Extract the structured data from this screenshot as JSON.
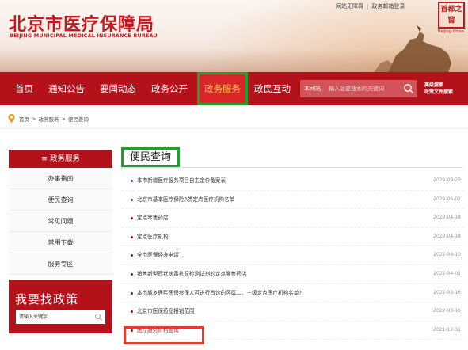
{
  "header": {
    "logo_title": "北京市医疗保障局",
    "logo_subtitle": "BEIJING MUNICIPAL MEDICAL INSURANCE BUREAU",
    "top_links": [
      "网站无障碍",
      "政务邮箱登录"
    ],
    "seal_text": "首都之窗",
    "seal_subtext": "Beijing-China"
  },
  "nav": {
    "items": [
      {
        "label": "首页"
      },
      {
        "label": "通知公告"
      },
      {
        "label": "要闻动态"
      },
      {
        "label": "政务公开"
      },
      {
        "label": "政务服务"
      },
      {
        "label": "政民互动"
      }
    ],
    "active": "政务服务",
    "search": {
      "scope_label": "本网站",
      "placeholder": "输入您要搜索的关键词"
    },
    "side_links": [
      "高级搜索",
      "政策文件搜索"
    ]
  },
  "breadcrumb": {
    "items": [
      "首页",
      "政务服务",
      "便民查询"
    ],
    "separator": ">"
  },
  "sidebar": {
    "heading": "≡ 政务服务",
    "items": [
      {
        "label": "办事指南"
      },
      {
        "label": "便民查询"
      },
      {
        "label": "常见问题"
      },
      {
        "label": "常用下载"
      },
      {
        "label": "服务专区"
      }
    ],
    "policy_title": "我要找政策",
    "policy_placeholder": "请输入关键字"
  },
  "main": {
    "title": "便民查询",
    "news": [
      {
        "title": "本市新增医疗服务项目自主定价备案表",
        "date": "2022-09-23"
      },
      {
        "title": "北京市基本医疗保险A类定点医疗机构名单",
        "date": "2022-06-02"
      },
      {
        "title": "定点零售药店",
        "date": "2022-04-18"
      },
      {
        "title": "定点医疗机构",
        "date": "2022-04-18"
      },
      {
        "title": "全市医保经办电话",
        "date": "2022-04-10"
      },
      {
        "title": "销售新型冠状病毒抗原检测试剂的定点零售药店",
        "date": "2022-04-01"
      },
      {
        "title": "本市城乡居民医保参保人可进行首诊的区属二、三级定点医疗机构名单?",
        "date": "2022-03-16"
      },
      {
        "title": "北京市医保药品报销范围",
        "date": "2022-03-16"
      },
      {
        "title": "医疗服务价格查询",
        "date": "2021-12-31",
        "highlighted": true
      }
    ]
  },
  "colors": {
    "brand_red": "#b3121a",
    "active_nav_bg": "#d9262b",
    "active_nav_text": "#ffd23f",
    "green_highlight": "#1fa12e",
    "red_highlight": "#e53b2f"
  }
}
